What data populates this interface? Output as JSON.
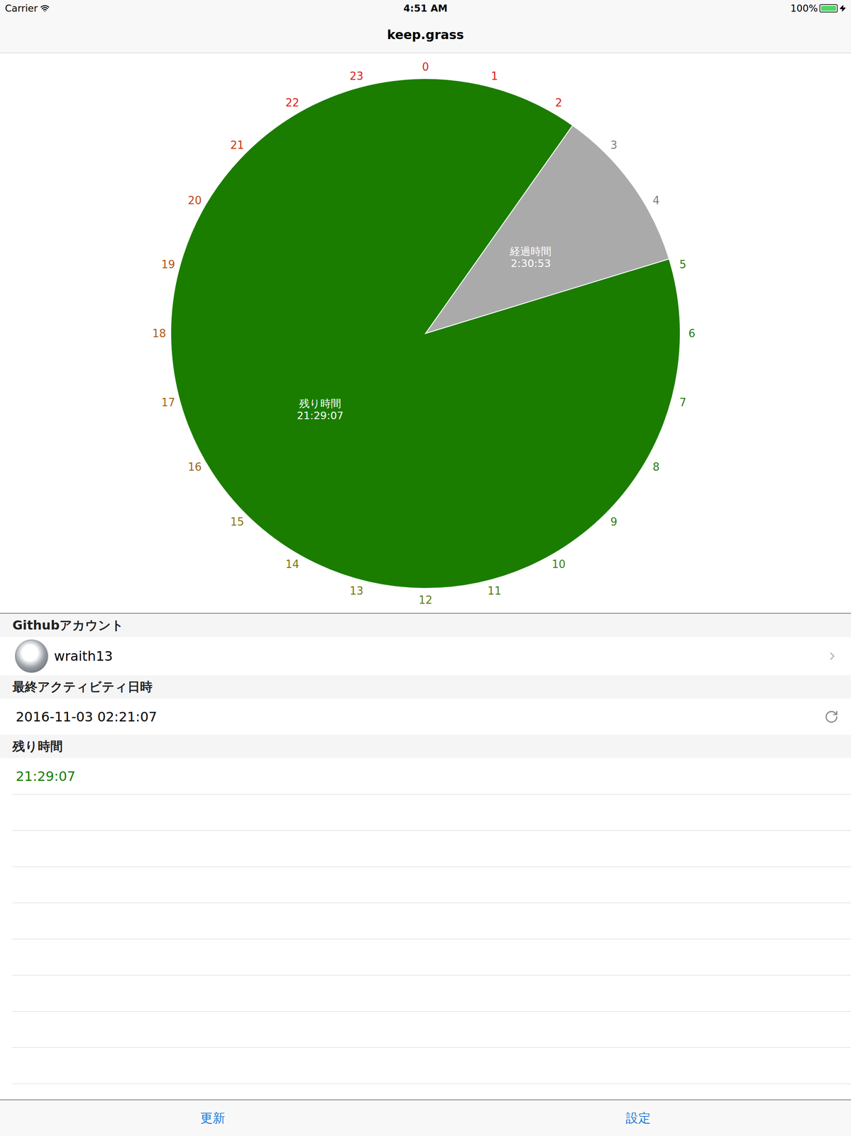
{
  "status_bar": {
    "carrier": "Carrier",
    "time": "4:51 AM",
    "battery": {
      "reading": "100%",
      "level": 1,
      "charging": true
    }
  },
  "nav": {
    "title": "keep.grass"
  },
  "chart": {
    "start_hour": 2.352,
    "hours": [
      {
        "label": "0",
        "color": "#e0201a"
      },
      {
        "label": "1",
        "color": "#e0201a"
      },
      {
        "label": "2",
        "color": "#e0201a"
      },
      {
        "label": "3",
        "color": "#808080"
      },
      {
        "label": "4",
        "color": "#808080"
      },
      {
        "label": "5",
        "color": "#2a7d10"
      },
      {
        "label": "6",
        "color": "#2a7d10"
      },
      {
        "label": "7",
        "color": "#2a7d10"
      },
      {
        "label": "8",
        "color": "#2f7d10"
      },
      {
        "label": "9",
        "color": "#367d10"
      },
      {
        "label": "10",
        "color": "#407d10"
      },
      {
        "label": "11",
        "color": "#4a7d10"
      },
      {
        "label": "12",
        "color": "#5c7d10"
      },
      {
        "label": "13",
        "color": "#6e7a10"
      },
      {
        "label": "14",
        "color": "#7e7510"
      },
      {
        "label": "15",
        "color": "#8a7010"
      },
      {
        "label": "16",
        "color": "#9a6510"
      },
      {
        "label": "17",
        "color": "#a86010"
      },
      {
        "label": "18",
        "color": "#b05a10"
      },
      {
        "label": "19",
        "color": "#b85010"
      },
      {
        "label": "20",
        "color": "#c04510"
      },
      {
        "label": "21",
        "color": "#cc3510"
      },
      {
        "label": "22",
        "color": "#e0201a"
      },
      {
        "label": "23",
        "color": "#e0201a"
      }
    ],
    "slices": [
      {
        "label": "経過時間",
        "value": "2:30:53",
        "hours": 2.515,
        "color": "#aaaaaa"
      },
      {
        "label": "残り時間",
        "value": "21:29:07",
        "hours": 21.485,
        "color": "#1a7d00"
      }
    ]
  },
  "sections": [
    {
      "header": "Githubアカウント",
      "kind": "account",
      "value": "wraith13",
      "color": "#000000"
    },
    {
      "header": "最終アクティビティ日時",
      "kind": "timestamp",
      "value": "2016-11-03 02:21:07",
      "color": "#000000"
    },
    {
      "header": "残り時間",
      "kind": "remaining",
      "value": "21:29:07",
      "color": "#1a7d00"
    }
  ],
  "toolbar": {
    "buttons": [
      "更新",
      "設定"
    ]
  }
}
